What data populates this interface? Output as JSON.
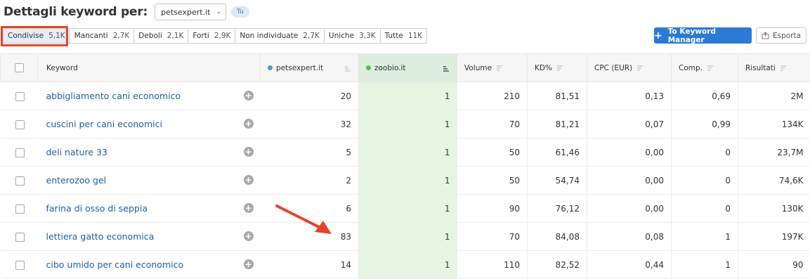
{
  "header": {
    "title": "Dettagli keyword per:",
    "domain_value": "petsexpert.it",
    "badge": "Tu"
  },
  "filters": [
    {
      "label": "Condivise",
      "count": "5,1K",
      "active": true
    },
    {
      "label": "Mancanti",
      "count": "2,7K"
    },
    {
      "label": "Deboli",
      "count": "2,1K"
    },
    {
      "label": "Forti",
      "count": "2,9K"
    },
    {
      "label": "Non individuate",
      "count": "2,7K"
    },
    {
      "label": "Uniche",
      "count": "3,3K"
    },
    {
      "label": "Tutte",
      "count": "11K"
    }
  ],
  "actions": {
    "keyword_manager": "To Keyword Manager",
    "export": "Esporta"
  },
  "colors": {
    "accent_blue": "#2b7bd6",
    "petsexpert_dot": "#4a9be3",
    "zoobio_dot": "#5cb85c",
    "highlight_red": "#e5442b",
    "zoobio_column_bg": "#e6f5e1"
  },
  "table": {
    "columns": {
      "keyword": "Keyword",
      "site1": "petsexpert.it",
      "site2": "zoobio.it",
      "volume": "Volume",
      "kd": "KD%",
      "cpc": "CPC (EUR)",
      "comp": "Comp.",
      "results": "Risultati"
    },
    "rows": [
      {
        "keyword": "abbigliamento cani economico",
        "site1": "20",
        "site2": "1",
        "volume": "210",
        "kd": "81,51",
        "cpc": "0,13",
        "comp": "0,69",
        "results": "2M"
      },
      {
        "keyword": "cuscini per cani economici",
        "site1": "32",
        "site2": "1",
        "volume": "70",
        "kd": "81,21",
        "cpc": "0,07",
        "comp": "0,99",
        "results": "134K"
      },
      {
        "keyword": "deli nature 33",
        "site1": "5",
        "site2": "1",
        "volume": "50",
        "kd": "61,46",
        "cpc": "0,00",
        "comp": "0",
        "results": "23,7M"
      },
      {
        "keyword": "enterozoo gel",
        "site1": "2",
        "site2": "1",
        "volume": "50",
        "kd": "54,74",
        "cpc": "0,00",
        "comp": "0",
        "results": "74,6K"
      },
      {
        "keyword": "farina di osso di seppia",
        "site1": "6",
        "site2": "1",
        "volume": "90",
        "kd": "76,12",
        "cpc": "0,00",
        "comp": "0",
        "results": "130K"
      },
      {
        "keyword": "lettiera gatto economica",
        "site1": "83",
        "site2": "1",
        "volume": "70",
        "kd": "84,08",
        "cpc": "0,08",
        "comp": "1",
        "results": "197K"
      },
      {
        "keyword": "cibo umido per cani economico",
        "site1": "14",
        "site2": "1",
        "volume": "110",
        "kd": "82,52",
        "cpc": "0,44",
        "comp": "1",
        "results": "90"
      }
    ]
  }
}
